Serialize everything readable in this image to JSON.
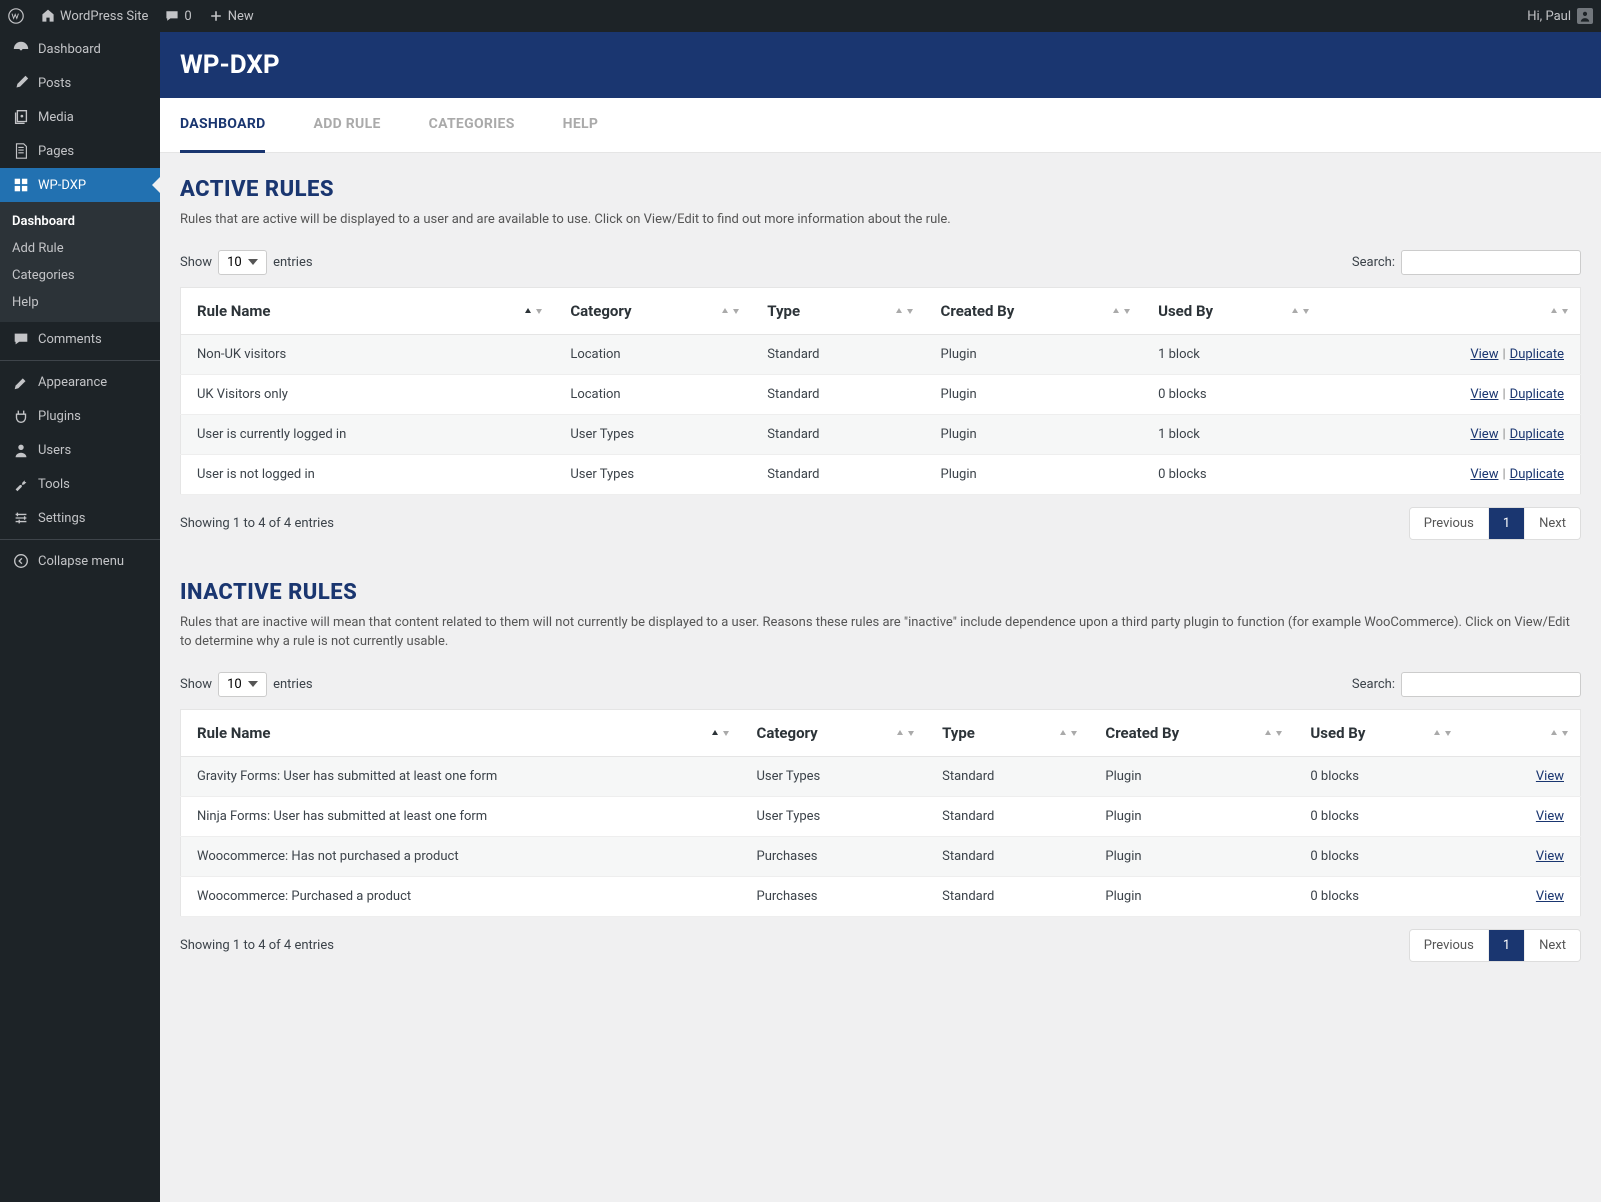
{
  "toolbar": {
    "site_name": "WordPress Site",
    "comments_count": "0",
    "new_label": "New",
    "greeting": "Hi, Paul"
  },
  "sidebar": {
    "items": [
      {
        "label": "Dashboard",
        "icon": "dashboard"
      },
      {
        "label": "Posts",
        "icon": "pin"
      },
      {
        "label": "Media",
        "icon": "media"
      },
      {
        "label": "Pages",
        "icon": "pages"
      },
      {
        "label": "WP-DXP",
        "icon": "wpdxp"
      },
      {
        "label": "Comments",
        "icon": "comments"
      },
      {
        "label": "Appearance",
        "icon": "appearance"
      },
      {
        "label": "Plugins",
        "icon": "plugins"
      },
      {
        "label": "Users",
        "icon": "users"
      },
      {
        "label": "Tools",
        "icon": "tools"
      },
      {
        "label": "Settings",
        "icon": "settings"
      },
      {
        "label": "Collapse menu",
        "icon": "collapse"
      }
    ],
    "submenu": {
      "items": [
        {
          "label": "Dashboard"
        },
        {
          "label": "Add Rule"
        },
        {
          "label": "Categories"
        },
        {
          "label": "Help"
        }
      ]
    }
  },
  "header": {
    "title": "WP-DXP"
  },
  "tabs": [
    {
      "label": "DASHBOARD",
      "active": true
    },
    {
      "label": "ADD RULE"
    },
    {
      "label": "CATEGORIES"
    },
    {
      "label": "HELP"
    }
  ],
  "active_rules": {
    "title": "ACTIVE RULES",
    "desc": "Rules that are active will be displayed to a user and are available to use. Click on View/Edit to find out more information about the rule.",
    "show_label": "Show",
    "entries_label": "entries",
    "page_length": "10",
    "search_label": "Search:",
    "columns": [
      "Rule Name",
      "Category",
      "Type",
      "Created By",
      "Used By",
      ""
    ],
    "rows": [
      {
        "name": "Non-UK visitors",
        "category": "Location",
        "type": "Standard",
        "created_by": "Plugin",
        "used_by": "1 block"
      },
      {
        "name": "UK Visitors only",
        "category": "Location",
        "type": "Standard",
        "created_by": "Plugin",
        "used_by": "0 blocks"
      },
      {
        "name": "User is currently logged in",
        "category": "User Types",
        "type": "Standard",
        "created_by": "Plugin",
        "used_by": "1 block"
      },
      {
        "name": "User is not logged in",
        "category": "User Types",
        "type": "Standard",
        "created_by": "Plugin",
        "used_by": "0 blocks"
      }
    ],
    "actions": {
      "view": "View",
      "duplicate": "Duplicate"
    },
    "info": "Showing 1 to 4 of 4 entries",
    "pagination": {
      "prev": "Previous",
      "page": "1",
      "next": "Next"
    }
  },
  "inactive_rules": {
    "title": "INACTIVE RULES",
    "desc": "Rules that are inactive will mean that content related to them will not currently be displayed to a user. Reasons these rules are \"inactive\" include dependence upon a third party plugin to function (for example WooCommerce). Click on View/Edit to determine why a rule is not currently usable.",
    "show_label": "Show",
    "entries_label": "entries",
    "page_length": "10",
    "search_label": "Search:",
    "columns": [
      "Rule Name",
      "Category",
      "Type",
      "Created By",
      "Used By",
      ""
    ],
    "rows": [
      {
        "name": "Gravity Forms: User has submitted at least one form",
        "category": "User Types",
        "type": "Standard",
        "created_by": "Plugin",
        "used_by": "0 blocks"
      },
      {
        "name": "Ninja Forms: User has submitted at least one form",
        "category": "User Types",
        "type": "Standard",
        "created_by": "Plugin",
        "used_by": "0 blocks"
      },
      {
        "name": "Woocommerce: Has not purchased a product",
        "category": "Purchases",
        "type": "Standard",
        "created_by": "Plugin",
        "used_by": "0 blocks"
      },
      {
        "name": "Woocommerce: Purchased a product",
        "category": "Purchases",
        "type": "Standard",
        "created_by": "Plugin",
        "used_by": "0 blocks"
      }
    ],
    "actions": {
      "view": "View"
    },
    "info": "Showing 1 to 4 of 4 entries",
    "pagination": {
      "prev": "Previous",
      "page": "1",
      "next": "Next"
    }
  }
}
